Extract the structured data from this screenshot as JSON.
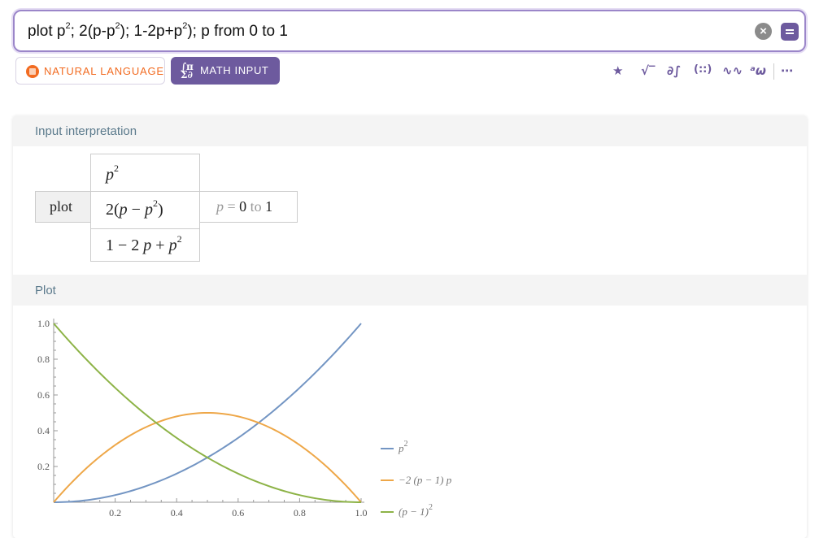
{
  "search": {
    "query_parts": [
      "plot p",
      "2",
      "; 2(p-p",
      "2",
      "); 1-2p+p",
      "2",
      "); p from 0 to 1"
    ]
  },
  "modes": {
    "natural_language": "NATURAL LANGUAGE",
    "math_input": "MATH INPUT"
  },
  "toolbar": {
    "icons": [
      "star-icon",
      "sqrt-icon",
      "calculus-icon",
      "matrix-icon",
      "waveform-icon",
      "greek-icon",
      "more-icon"
    ],
    "glyphs": [
      "★",
      "√‾",
      "∂∫",
      "(::)",
      "∿∿",
      "ᵃω",
      "⋯"
    ]
  },
  "pods": {
    "input_title": "Input interpretation",
    "plot_title": "Plot"
  },
  "interpretation": {
    "command": "plot",
    "f1_base": "p",
    "f1_exp": "2",
    "f2_pre": "2(",
    "f2_var": "p",
    "f2_mid": " − ",
    "f2_var2": "p",
    "f2_exp": "2",
    "f2_post": ")",
    "f3_pre": "1 − 2 ",
    "f3_var": "p",
    "f3_mid": " + ",
    "f3_var2": "p",
    "f3_exp": "2",
    "range_var": "p",
    "range_eq": " = ",
    "range_from": "0",
    "range_to_word": " to ",
    "range_to": "1"
  },
  "colors": {
    "accent": "#6d5a9e",
    "natural_language": "#f26b21",
    "series_blue": "#7395c3",
    "series_orange": "#eea748",
    "series_green": "#8db347"
  },
  "chart_data": {
    "type": "line",
    "x_range": [
      0,
      1
    ],
    "ylim": [
      0,
      1
    ],
    "x_ticks": [
      "0.2",
      "0.4",
      "0.6",
      "0.8",
      "1.0"
    ],
    "y_ticks": [
      "0.2",
      "0.4",
      "0.6",
      "0.8",
      "1.0"
    ],
    "legend_position": "right",
    "series": [
      {
        "name": "p²",
        "legend_base": "p",
        "legend_exp": "2",
        "color": "#7395c3",
        "x": [
          0,
          0.1,
          0.2,
          0.3,
          0.4,
          0.5,
          0.6,
          0.7,
          0.8,
          0.9,
          1.0
        ],
        "y": [
          0,
          0.01,
          0.04,
          0.09,
          0.16,
          0.25,
          0.36,
          0.49,
          0.64,
          0.81,
          1.0
        ]
      },
      {
        "name": "−2(p−1) p",
        "legend_base": "−2 (p − 1) p",
        "legend_exp": "",
        "color": "#eea748",
        "x": [
          0,
          0.1,
          0.2,
          0.3,
          0.4,
          0.5,
          0.6,
          0.7,
          0.8,
          0.9,
          1.0
        ],
        "y": [
          0,
          0.18,
          0.32,
          0.42,
          0.48,
          0.5,
          0.48,
          0.42,
          0.32,
          0.18,
          0
        ]
      },
      {
        "name": "(p−1)²",
        "legend_base": "(p − 1)",
        "legend_exp": "2",
        "color": "#8db347",
        "x": [
          0,
          0.1,
          0.2,
          0.3,
          0.4,
          0.5,
          0.6,
          0.7,
          0.8,
          0.9,
          1.0
        ],
        "y": [
          1.0,
          0.81,
          0.64,
          0.49,
          0.36,
          0.25,
          0.16,
          0.09,
          0.04,
          0.01,
          0
        ]
      }
    ]
  }
}
